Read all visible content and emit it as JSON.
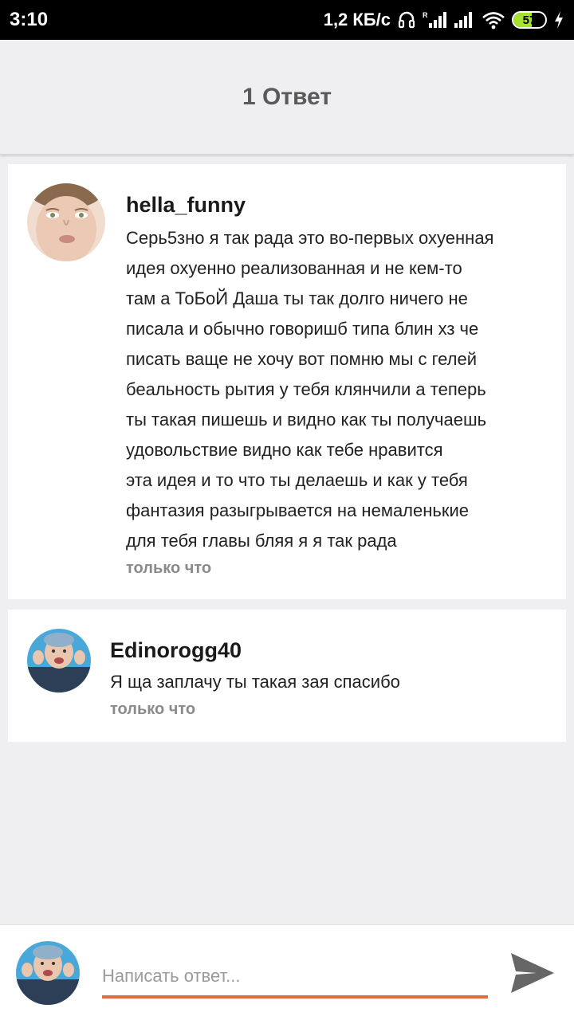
{
  "status_bar": {
    "time": "3:10",
    "speed": "1,2 КБ/с",
    "battery_level": 57,
    "battery_text": "57"
  },
  "header": {
    "title": "1 Ответ"
  },
  "comments": [
    {
      "username": "hella_funny",
      "lines": [
        "Серь5зно я так рада это во-первых охуенная",
        "идея охуенно реализованная и не кем-то",
        "там а ТоБоЙ Даша ты так долго ничего не",
        "писала и обычно говоришб типа блин хз че",
        "писать ваще не хочу вот помню мы с гелей",
        "беальность рытия у тебя клянчили а теперь",
        "ты такая пишешь и видно как ты получаешь",
        "удовольствие видно как тебе нравится",
        "эта идея и то что ты делаешь и как у тебя",
        "фантазия разыгрывается на немаленькие",
        "для тебя главы бляя я  я так рада"
      ],
      "timestamp": "только что"
    },
    {
      "username": "Edinorogg40",
      "lines": [
        "Я ща заплачу ты такая зая спасибо"
      ],
      "timestamp": "только что"
    }
  ],
  "reply": {
    "placeholder": "Написать ответ...",
    "value": ""
  },
  "colors": {
    "accent": "#e0703a",
    "battery": "#a6e22e",
    "background": "#efeff2"
  },
  "icons": [
    "headphones-icon",
    "signal-icon",
    "wifi-icon",
    "battery-icon",
    "charging-icon",
    "send-icon"
  ]
}
